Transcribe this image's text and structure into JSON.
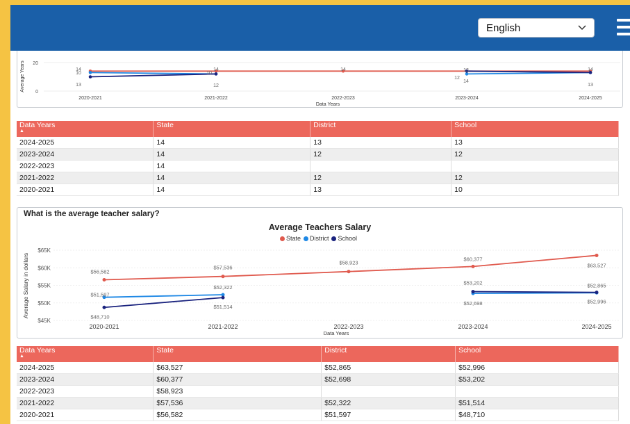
{
  "header": {
    "language": "English",
    "colors": {
      "bar": "#1a5fa8",
      "accent": "#ec675c"
    }
  },
  "top_chart_data": {
    "type": "line",
    "categories": [
      "2020-2021",
      "2021-2022",
      "2022-2023",
      "2023-2024",
      "2024-2025"
    ],
    "series": [
      {
        "name": "State",
        "color": "#e05a4e",
        "values": [
          14,
          14,
          14,
          14,
          14
        ]
      },
      {
        "name": "District",
        "color": "#1e88e5",
        "values": [
          13,
          12,
          null,
          12,
          13
        ]
      },
      {
        "name": "School",
        "color": "#1a237e",
        "values": [
          10,
          12,
          null,
          14,
          13
        ]
      }
    ],
    "ylabel": "Average Years",
    "xlabel": "Data Years",
    "y_ticks": [
      "20",
      "0"
    ],
    "ylim": [
      0,
      20
    ],
    "labels": {
      "state": [
        "14",
        "14",
        "14",
        "12",
        "14"
      ],
      "district": [
        "13",
        "12",
        "",
        "14",
        "13"
      ],
      "school": [
        "10",
        "10",
        "",
        "12",
        ""
      ]
    }
  },
  "years_table": {
    "headers": [
      "Data Years",
      "State",
      "District",
      "School"
    ],
    "sort_arrow": "▲",
    "rows": [
      [
        "2024-2025",
        "14",
        "13",
        "13"
      ],
      [
        "2023-2024",
        "14",
        "12",
        "12"
      ],
      [
        "2022-2023",
        "14",
        "",
        ""
      ],
      [
        "2021-2022",
        "14",
        "12",
        "12"
      ],
      [
        "2020-2021",
        "14",
        "13",
        "10"
      ]
    ]
  },
  "salary_section": {
    "question": "What is the average teacher salary?"
  },
  "chart_data": {
    "type": "line",
    "title": "Average Teachers Salary",
    "categories": [
      "2020-2021",
      "2021-2022",
      "2022-2023",
      "2023-2024",
      "2024-2025"
    ],
    "series": [
      {
        "name": "State",
        "color": "#e05a4e",
        "values": [
          56582,
          57536,
          58923,
          60377,
          63527
        ],
        "labels": [
          "$56,582",
          "$57,536",
          "$58,923",
          "$60,377",
          "$63,527"
        ]
      },
      {
        "name": "District",
        "color": "#1e88e5",
        "values": [
          51597,
          52322,
          null,
          52698,
          52865
        ],
        "labels": [
          "$51,597",
          "$52,322",
          "",
          "$52,698",
          "$52,865"
        ]
      },
      {
        "name": "School",
        "color": "#1a237e",
        "values": [
          48710,
          51514,
          null,
          53202,
          52996
        ],
        "labels": [
          "$48,710",
          "$51,514",
          "",
          "$53,202",
          "$52,996"
        ]
      }
    ],
    "y_ticks": [
      "$65K",
      "$60K",
      "$55K",
      "$50K",
      "$45K"
    ],
    "ylim": [
      45000,
      65000
    ],
    "xlabel": "Data Years",
    "ylabel": "Average Salary in dollars",
    "legend_position": "top-center"
  },
  "salary_table": {
    "headers": [
      "Data Years",
      "State",
      "District",
      "School"
    ],
    "sort_arrow": "▲",
    "rows": [
      [
        "2024-2025",
        "$63,527",
        "$52,865",
        "$52,996"
      ],
      [
        "2023-2024",
        "$60,377",
        "$52,698",
        "$53,202"
      ],
      [
        "2022-2023",
        "$58,923",
        "",
        ""
      ],
      [
        "2021-2022",
        "$57,536",
        "$52,322",
        "$51,514"
      ],
      [
        "2020-2021",
        "$56,582",
        "$51,597",
        "$48,710"
      ]
    ]
  }
}
